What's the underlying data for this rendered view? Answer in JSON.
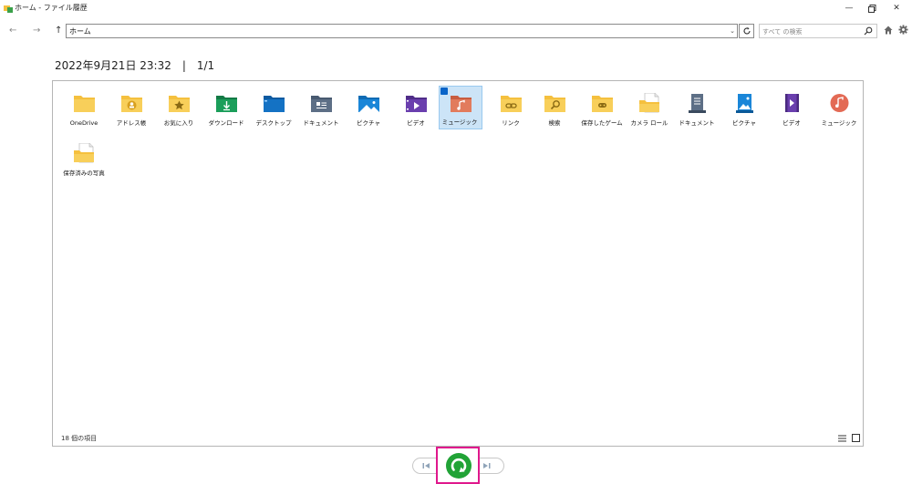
{
  "window": {
    "title": "ホーム - ファイル履歴",
    "minimize": "—",
    "restore": "▫",
    "close": "✕"
  },
  "nav": {
    "back": "←",
    "forward": "→",
    "up": "↑"
  },
  "address": {
    "path": "ホーム"
  },
  "search": {
    "placeholder": "すべて の検索"
  },
  "snapshot": {
    "label": "2022年9月21日 23:32　|　1/1"
  },
  "items": [
    {
      "label": "OneDrive",
      "icon": "folder-onedrive-icon",
      "color": "#f5c03e"
    },
    {
      "label": "アドレス帳",
      "icon": "folder-contacts-icon",
      "color": "#f5c03e"
    },
    {
      "label": "お気に入り",
      "icon": "folder-favorites-icon",
      "color": "#f5c03e"
    },
    {
      "label": "ダウンロード",
      "icon": "folder-downloads-icon",
      "color": "#1b9e5a"
    },
    {
      "label": "デスクトップ",
      "icon": "folder-desktop-icon",
      "color": "#1472c4"
    },
    {
      "label": "ドキュメント",
      "icon": "folder-documents-icon",
      "color": "#5d6f86"
    },
    {
      "label": "ピクチャ",
      "icon": "folder-pictures-icon",
      "color": "#1a86d8"
    },
    {
      "label": "ビデオ",
      "icon": "folder-videos-icon",
      "color": "#6a3fae"
    },
    {
      "label": "ミュージック",
      "icon": "folder-music-icon",
      "color": "#e27b5c",
      "selected": true
    },
    {
      "label": "リンク",
      "icon": "folder-links-icon",
      "color": "#f5c03e"
    },
    {
      "label": "検索",
      "icon": "folder-searches-icon",
      "color": "#f5c03e"
    },
    {
      "label": "保存したゲーム",
      "icon": "folder-games-icon",
      "color": "#f5c03e"
    },
    {
      "label": "カメラ ロール",
      "icon": "folder-camera-roll-icon",
      "color": "#f5c03e"
    },
    {
      "label": "ドキュメント",
      "icon": "library-documents-icon",
      "color": "#5d6f86"
    },
    {
      "label": "ピクチャ",
      "icon": "library-pictures-icon",
      "color": "#1a86d8"
    },
    {
      "label": "ビデオ",
      "icon": "library-videos-icon",
      "color": "#6a3fae"
    },
    {
      "label": "ミュージック",
      "icon": "library-music-icon",
      "color": "#e36a55"
    },
    {
      "label": "保存済みの写真",
      "icon": "folder-saved-pictures-icon",
      "color": "#f5c03e"
    }
  ],
  "status": {
    "count": "18 個の項目"
  },
  "colors": {
    "accent": "#0a64c8",
    "restore_button": "#21a336",
    "highlight_frame": "#e0188c",
    "selection": "#cce4f7"
  }
}
